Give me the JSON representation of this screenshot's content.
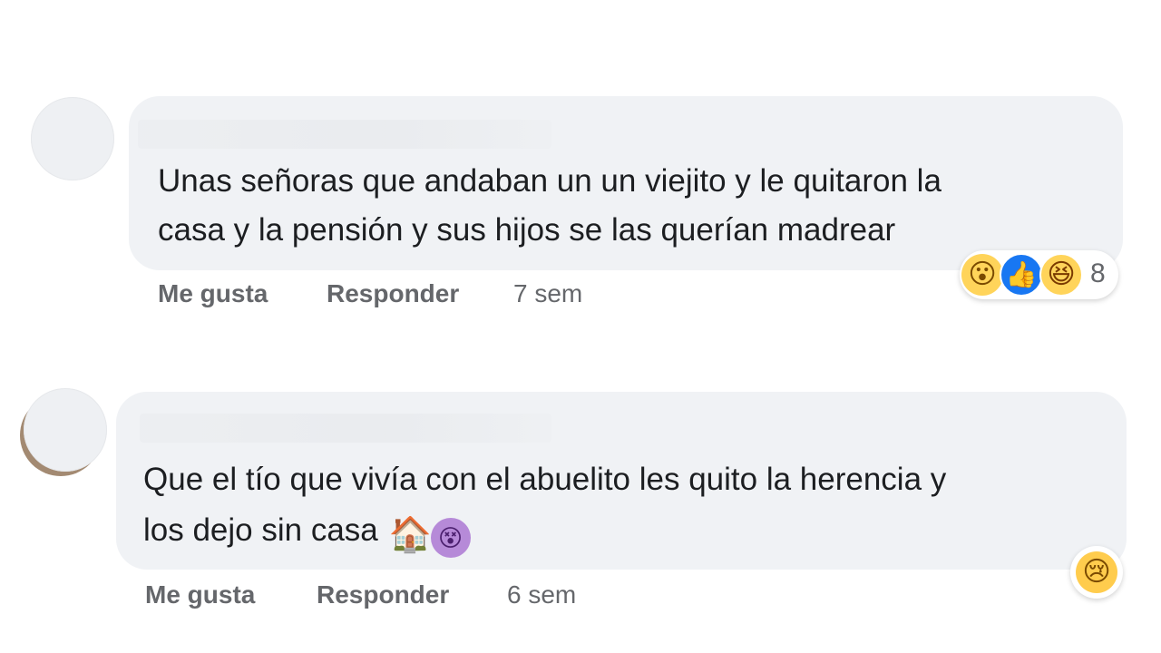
{
  "comments": [
    {
      "text_line1": "Unas señoras que andaban un un viejito y le quitaron la",
      "text_line2": "casa y la pensión y sus hijos se las querían madrear",
      "like_label": "Me gusta",
      "reply_label": "Responder",
      "time": "7 sem",
      "reactions": [
        "wow-reaction-icon",
        "like-reaction-icon",
        "haha-reaction-icon"
      ],
      "reaction_count": "8"
    },
    {
      "text_line1": "Que el tío que vivía con el abuelito les quito la herencia y",
      "text_line2": "los dejo sin casa",
      "inline_emojis": [
        "house-emoji",
        "dizzy-face-emoji"
      ],
      "like_label": "Me gusta",
      "reply_label": "Responder",
      "time": "6 sem",
      "reactions": [
        "sad-reaction-icon"
      ]
    }
  ],
  "colors": {
    "bubble": "#f0f2f5",
    "text": "#1c1e21",
    "meta": "#65676b",
    "like_blue": "#1877f2"
  }
}
